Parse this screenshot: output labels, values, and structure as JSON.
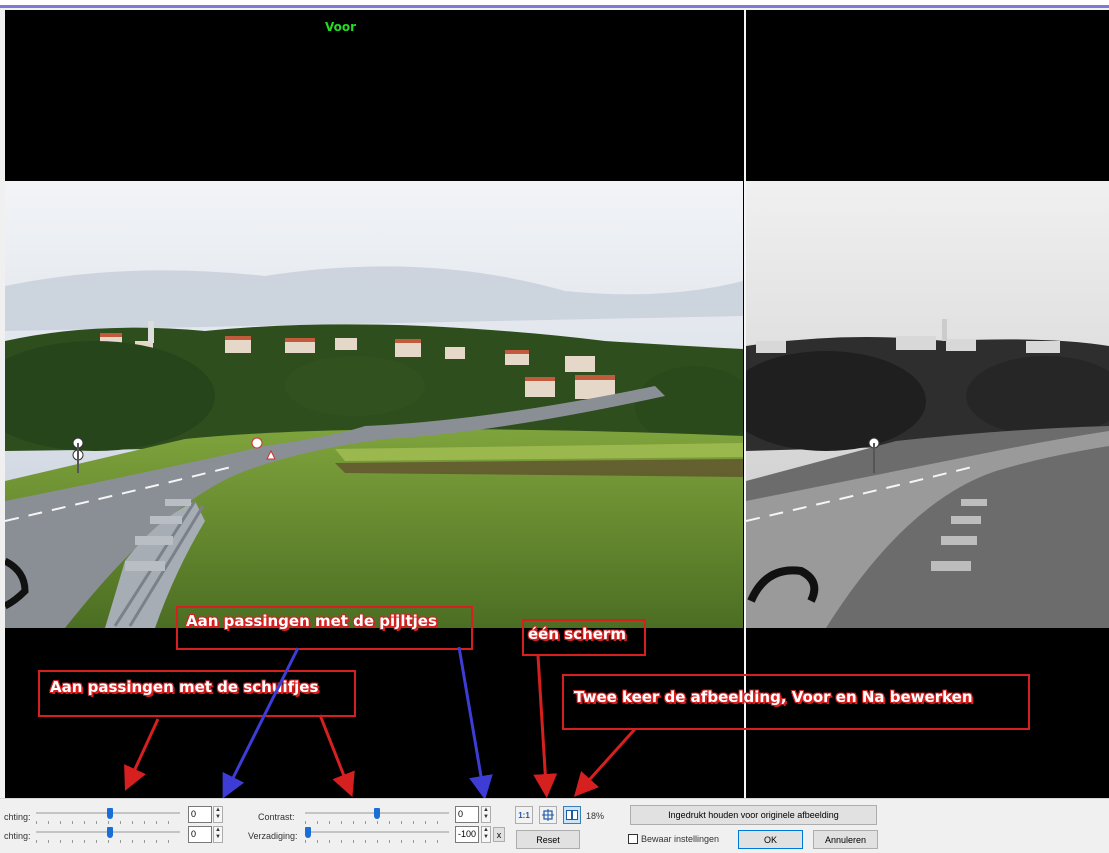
{
  "preview": {
    "before_label": "Voor"
  },
  "annotations": {
    "sliders": "Aan passingen met de schuifjes",
    "arrows": "Aan passingen met de pijltjes",
    "one_screen": "één scherm",
    "two_images": "Twee keer de afbeelding, Voor en Na bewerken"
  },
  "controls": {
    "row1_label": "chting:",
    "row2_label": "chting:",
    "row1_value": "0",
    "row2_value": "0",
    "contrast_label": "Contrast:",
    "contrast_value": "0",
    "saturation_label": "Verzadiging:",
    "saturation_value": "-100",
    "clear_label": "x",
    "zoom_1to1": "1:1",
    "fit_icon": "fit-icon",
    "split_icon": "split-view-icon",
    "zoom_percent": "18%",
    "reset_label": "Reset",
    "hold_original_label": "Ingedrukt houden voor originele afbeelding",
    "save_settings_label": "Bewaar instellingen",
    "ok_label": "OK",
    "cancel_label": "Annuleren"
  },
  "colors": {
    "accent": "#1a6fd6",
    "annotation_red": "#d62020",
    "arrow_blue": "#3d3dd6",
    "voor_green": "#22dd22"
  }
}
